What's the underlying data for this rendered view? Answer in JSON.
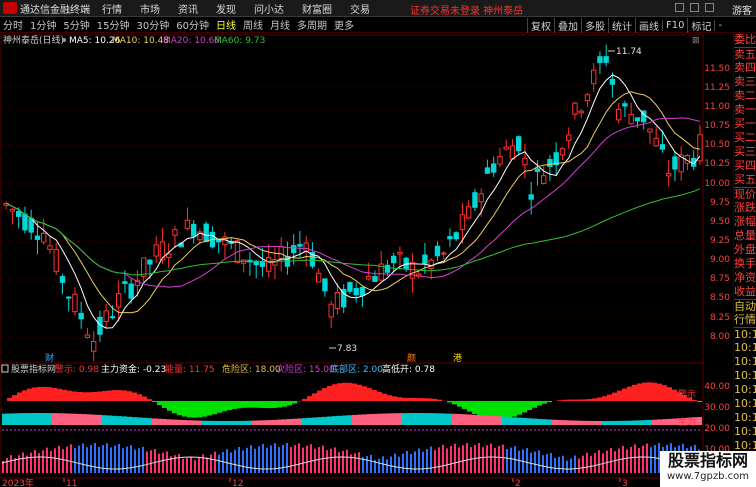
{
  "topbar": {
    "app_title": "通达信金融终端",
    "menus": [
      "行情",
      "市场",
      "资讯",
      "发现",
      "问小达",
      "财富圈",
      "交易"
    ],
    "alert": "证券交易未登录  神州泰岳",
    "guest": "游客"
  },
  "periods": [
    "分时",
    "1分钟",
    "5分钟",
    "15分钟",
    "30分钟",
    "60分钟",
    "日线",
    "周线",
    "月线",
    "多周期",
    "更多"
  ],
  "active_period": "日线",
  "tools": [
    "叠加",
    "多股",
    "统计",
    "画线",
    "F10",
    "标记",
    "-"
  ],
  "tools_first": "复权",
  "main_chart": {
    "legend": {
      "stock": "神州泰岳(日线)",
      "ma5": "MA5: 10.26",
      "ma10": "MA10: 10.48",
      "ma20": "MA20: 10.66",
      "ma60": "MA60: 9.73"
    },
    "yticks": [
      "11.50",
      "11.25",
      "11.00",
      "10.75",
      "10.50",
      "10.25",
      "10.00",
      "9.75",
      "9.50",
      "9.25",
      "9.00",
      "8.75",
      "8.50",
      "8.25",
      "8.00"
    ],
    "high_label": "11.74",
    "low_label": "7.83",
    "markers": [
      "财",
      "颜",
      "港"
    ],
    "colors": {
      "up": "#ff3030",
      "down": "#00d8d8",
      "ma5": "#ffffff",
      "ma10": "#e8d060",
      "ma20": "#d040d0",
      "ma60": "#30c030"
    }
  },
  "indicator": {
    "title": "股票指标网",
    "items": [
      {
        "label": "警示: 0.98",
        "color": "#ff3030"
      },
      {
        "label": "主力资金: -0.23",
        "color": "#ffffff"
      },
      {
        "label": "能量: 11.75",
        "color": "#ff3030"
      },
      {
        "label": "危险区: 18.00",
        "color": "#e0c040"
      },
      {
        "label": "次险区: 15.00",
        "color": "#d040d0"
      },
      {
        "label": "底部区: 2.00",
        "color": "#40c0ff"
      },
      {
        "label": "高低开: 0.78",
        "color": "#ffffff"
      }
    ],
    "yticks": [
      "40.00",
      "30.00",
      "20.00",
      "10.00"
    ],
    "tag_warning": "警示",
    "tag_main": "主力"
  },
  "xaxis": {
    "labels": [
      "2023年",
      "11",
      "12",
      "2",
      "3"
    ]
  },
  "right_panel": [
    "委比",
    "卖五",
    "卖四",
    "卖三",
    "卖二",
    "卖一",
    "买一",
    "买二",
    "买三",
    "买四",
    "买五",
    "现价",
    "涨跌",
    "涨幅",
    "总量",
    "外盘",
    "换手",
    "净资",
    "收益",
    "自动",
    "行情",
    "10:1",
    "10:1",
    "10:1",
    "10:1",
    "10:1",
    "10:1",
    "10:1",
    "10:1",
    "10:1",
    "10:1",
    "10:1",
    "10:1"
  ],
  "watermark": {
    "main": "股票指标网",
    "sub": "www.7gpzb.com"
  }
}
